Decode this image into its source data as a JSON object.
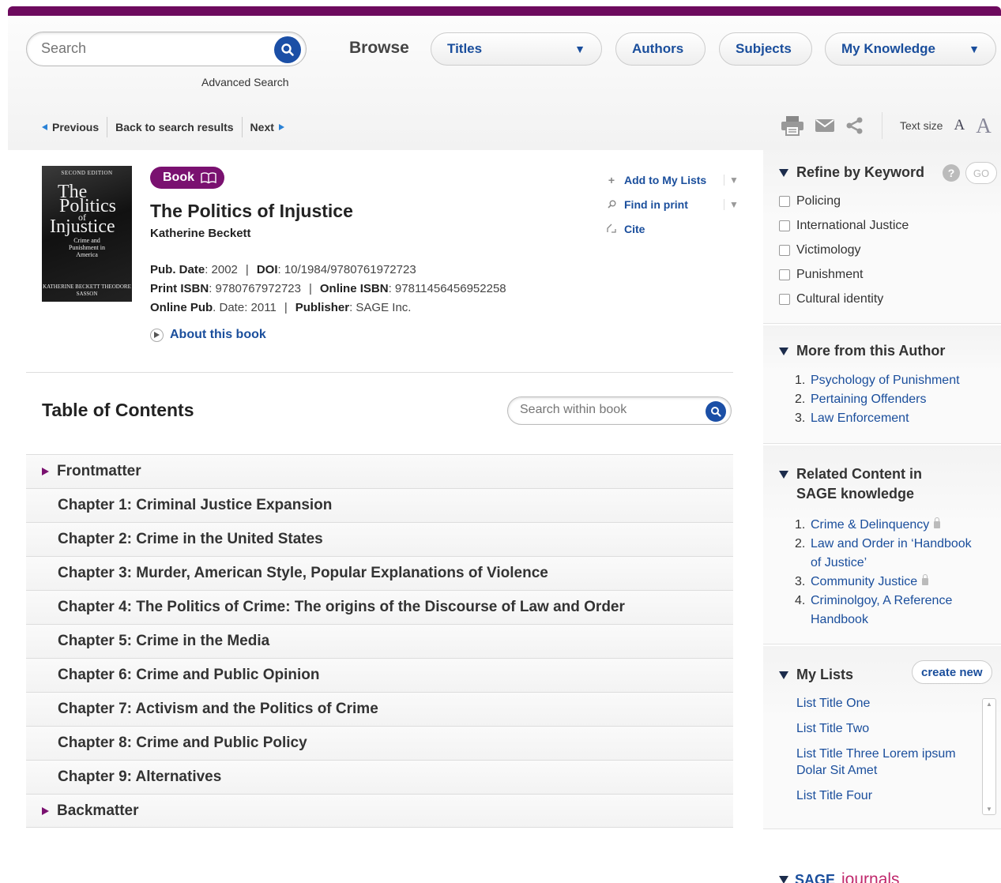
{
  "header": {
    "search_placeholder": "Search",
    "advanced_search": "Advanced Search",
    "browse_label": "Browse",
    "nav": {
      "titles": "Titles",
      "authors": "Authors",
      "subjects": "Subjects",
      "my_knowledge": "My Knowledge"
    }
  },
  "result_nav": {
    "previous": "Previous",
    "back": "Back to search results",
    "next": "Next"
  },
  "tools": {
    "text_size_label": "Text size",
    "size_small": "A",
    "size_large": "A"
  },
  "book": {
    "badge": "Book",
    "title": "The Politics of Injustice",
    "author": "Katherine Beckett",
    "pub_date_label": "Pub. Date",
    "pub_date": "2002",
    "doi_label": "DOI",
    "doi": "10/1984/9780761972723",
    "print_isbn_label": "Print ISBN",
    "print_isbn": "9780767972723",
    "online_isbn_label": "Online ISBN",
    "online_isbn": "97811456456952258",
    "online_pub_label": "Online Pub",
    "online_pub_date_label": ". Date",
    "online_pub": "2011",
    "publisher_label": "Publisher",
    "publisher": "SAGE Inc.",
    "about": "About this book",
    "cover": {
      "edition": "SECOND EDITION",
      "line1": "The",
      "line2": "Politics",
      "line3": "of",
      "line4": "Injustice",
      "subtitle": "Crime and Punishment in America",
      "authors": "KATHERINE BECKETT THEODORE SASSON"
    }
  },
  "actions": {
    "add_to_lists": "Add to My Lists",
    "find_in_print": "Find in print",
    "cite": "Cite"
  },
  "toc": {
    "heading": "Table of Contents",
    "search_placeholder": "Search within book",
    "rows": [
      "Frontmatter",
      "Chapter 1: Criminal Justice Expansion",
      "Chapter 2: Crime in the United States",
      "Chapter 3: Murder, American Style, Popular Explanations of Violence",
      "Chapter 4: The Politics of Crime: The origins of the Discourse of Law and Order",
      "Chapter 5: Crime in the Media",
      "Chapter 6: Crime and Public Opinion",
      "Chapter 7: Activism and the Politics of Crime",
      "Chapter 8: Crime and Public Policy",
      "Chapter 9: Alternatives",
      "Backmatter"
    ]
  },
  "sidebar": {
    "refine": {
      "title": "Refine by Keyword",
      "help": "?",
      "go": "GO",
      "keywords": [
        "Policing",
        "International Justice",
        "Victimology",
        "Punishment",
        "Cultural identity"
      ]
    },
    "more_author": {
      "title": "More from this Author",
      "items": [
        "Psychology of Punishment",
        "Pertaining Offenders",
        "Law Enforcement"
      ]
    },
    "related": {
      "title_line1": "Related Content in",
      "title_line2": "SAGE knowledge",
      "items": [
        {
          "num": "1.",
          "text": "Crime & Delinquency",
          "locked": true
        },
        {
          "num": "2.",
          "text": "Law and Order in ‘Handbook of Justice’",
          "locked": false
        },
        {
          "num": "3.",
          "text": "Community Justice",
          "locked": true
        },
        {
          "num": "4.",
          "text": "Criminolgoy, A Reference Handbook",
          "locked": false
        }
      ]
    },
    "my_lists": {
      "title": "My Lists",
      "create": "create new",
      "items": [
        "List Title One",
        "List Title Two",
        "List Title Three Lorem ipsum Dolar Sit Amet",
        "List Title Four"
      ]
    },
    "journals": {
      "brand": "SAGE",
      "label": "journals"
    }
  },
  "colors": {
    "brand_purple": "#6d0a5e",
    "link_blue": "#1a4e9c",
    "search_button": "#1b4fa6"
  }
}
